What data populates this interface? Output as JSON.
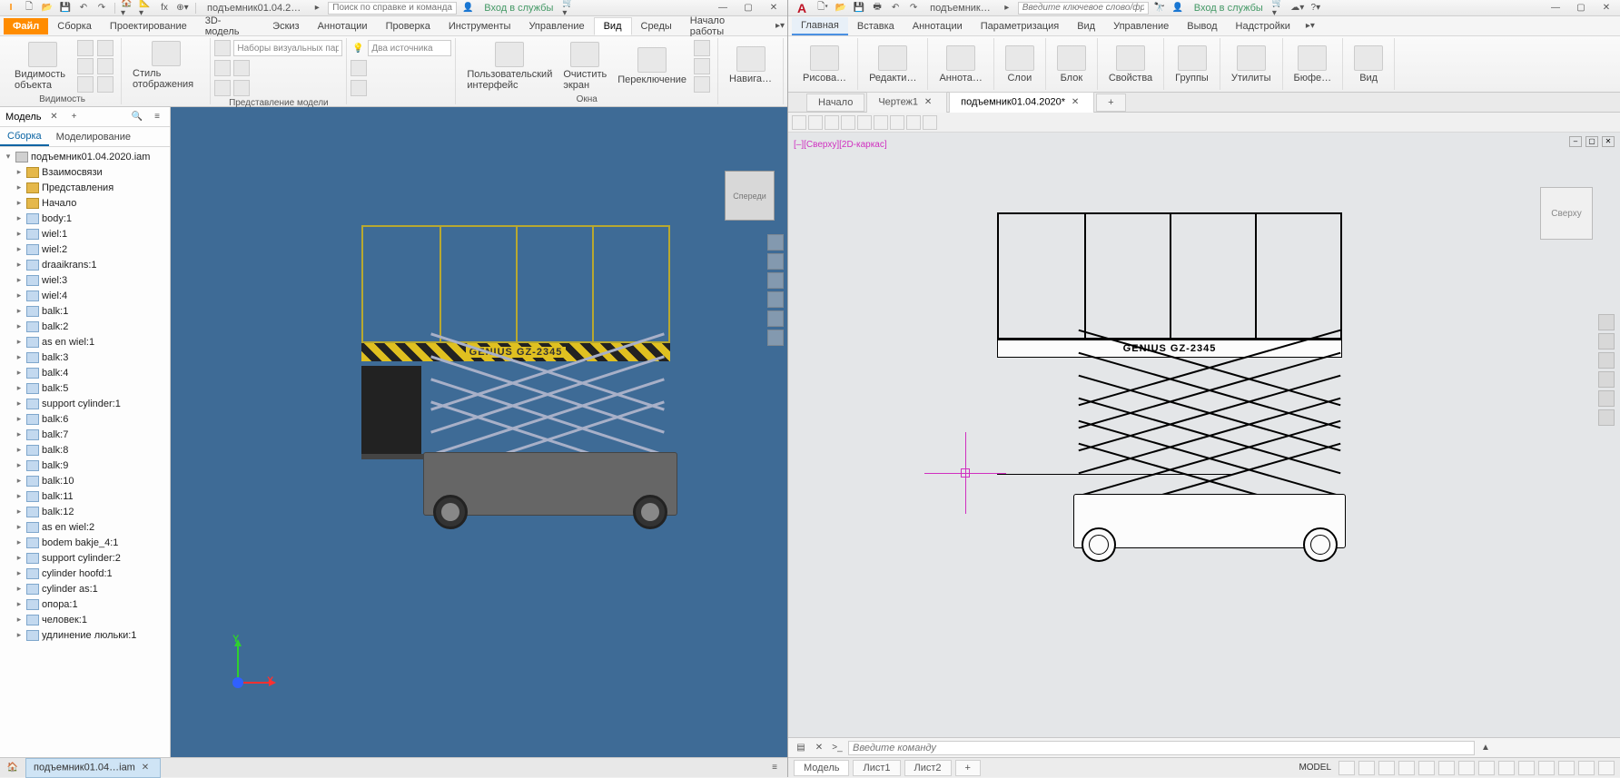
{
  "inventor": {
    "titlebar": {
      "doc": "подъемник01.04.2…",
      "search_placeholder": "Поиск по справке и командам…",
      "signin": "Вход в службы"
    },
    "file_tab": "Файл",
    "tabs": [
      "Сборка",
      "Проектирование",
      "3D-модель",
      "Эскиз",
      "Аннотации",
      "Проверка",
      "Инструменты",
      "Управление",
      "Вид",
      "Среды",
      "Начало работы"
    ],
    "active_tab_index": 8,
    "ribbon": {
      "visibility_big": "Видимость объекта",
      "visibility_grp": "Видимость",
      "style": "Стиль отображения",
      "model_view_grp": "Представление модели",
      "visual_sets": "Наборы визуальных пара…",
      "two_sources": "Два источника",
      "user_if": "Пользовательский интерфейс",
      "clear_screen": "Очистить экран",
      "switch": "Переключение",
      "windows_grp": "Окна",
      "nav": "Навига…"
    },
    "browser": {
      "title": "Модель",
      "tabs": [
        "Сборка",
        "Моделирование"
      ],
      "active_tab": 0,
      "root": "подъемник01.04.2020.iam",
      "folders": [
        "Взаимосвязи",
        "Представления",
        "Начало"
      ],
      "parts": [
        "body:1",
        "wiel:1",
        "wiel:2",
        "draaikrans:1",
        "wiel:3",
        "wiel:4",
        "balk:1",
        "balk:2",
        "as en wiel:1",
        "balk:3",
        "balk:4",
        "balk:5",
        "support cylinder:1",
        "balk:6",
        "balk:7",
        "balk:8",
        "balk:9",
        "balk:10",
        "balk:11",
        "balk:12",
        "as en wiel:2",
        "bodem bakje_4:1",
        "support cylinder:2",
        "cylinder hoofd:1",
        "cylinder as:1",
        "опора:1",
        "человек:1",
        "удлинение люльки:1"
      ]
    },
    "viewport": {
      "cube": "Спереди",
      "lift_label": "GENIUS GZ-2345",
      "ax_x": "X",
      "ax_y": "Y"
    },
    "doc_tab": "подъемник01.04…iam"
  },
  "autocad": {
    "titlebar": {
      "doc": "подъемник…",
      "search_placeholder": "Введите ключевое слово/фразу",
      "signin": "Вход в службы"
    },
    "tabs": [
      "Главная",
      "Вставка",
      "Аннотации",
      "Параметризация",
      "Вид",
      "Управление",
      "Вывод",
      "Надстройки"
    ],
    "active_tab_index": 0,
    "ribbon_groups": [
      "Рисова…",
      "Редакти…",
      "Аннота…",
      "Слои",
      "Блок",
      "Свойства",
      "Группы",
      "Утилиты",
      "Бюфе…",
      "Вид"
    ],
    "doctabs": [
      "Начало",
      "Чертеж1",
      "подъемник01.04.2020*"
    ],
    "active_doctab": 2,
    "view_label": "[–][Сверху][2D-каркас]",
    "viewcube": "Сверху",
    "lift_label": "GENIUS GZ-2345",
    "cmd_placeholder": "Введите команду",
    "status": {
      "tabs": [
        "Модель",
        "Лист1",
        "Лист2"
      ],
      "active": 0,
      "model_label": "MODEL"
    }
  }
}
